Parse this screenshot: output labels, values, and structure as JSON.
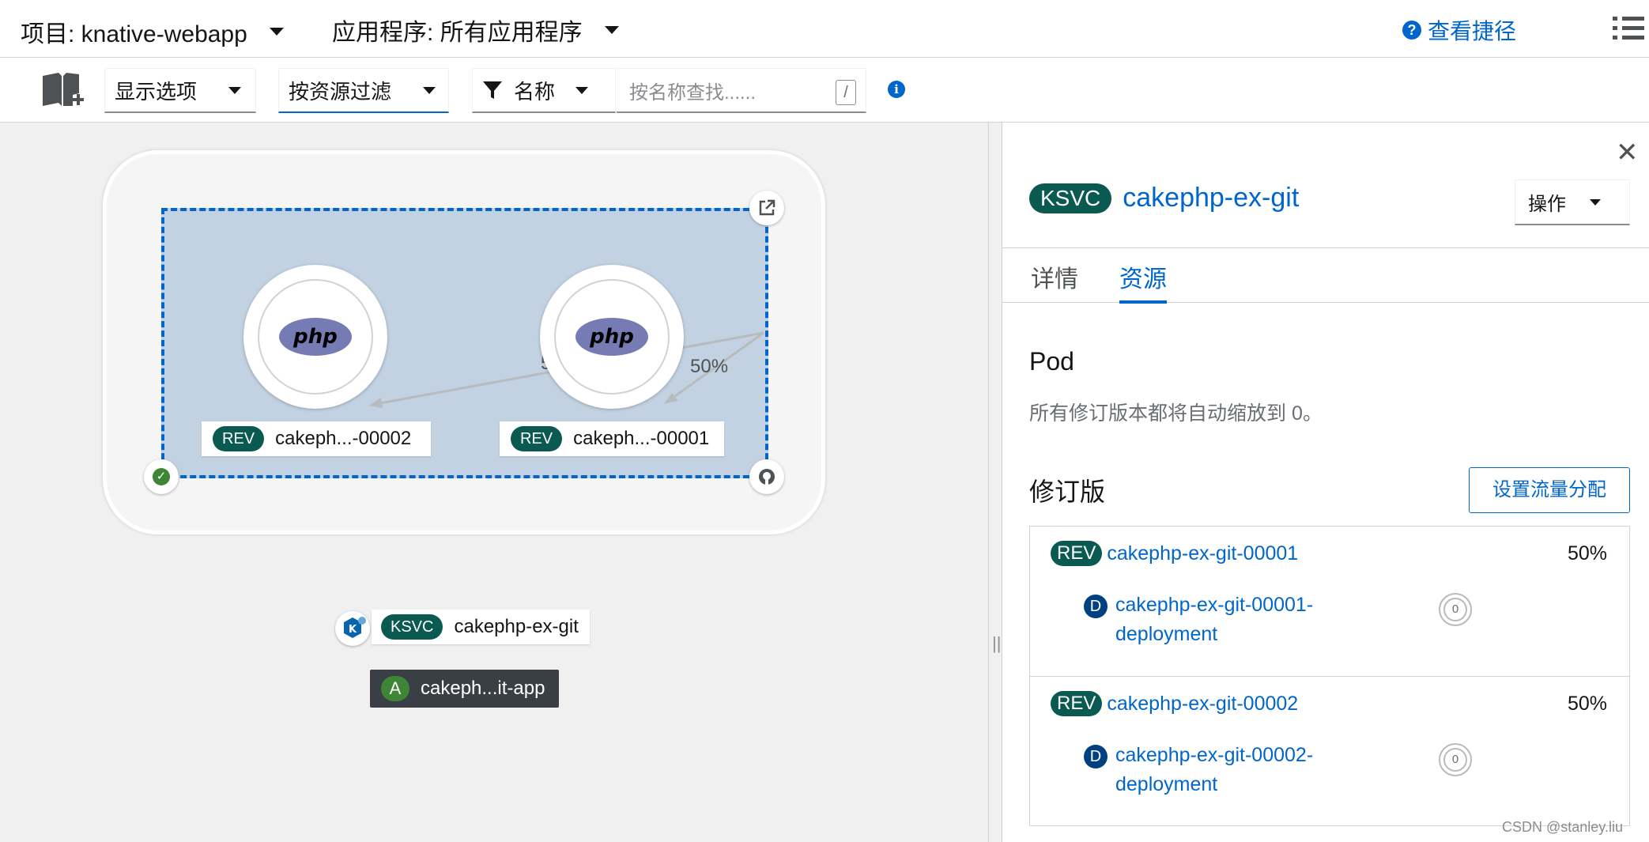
{
  "topbar": {
    "project": "项目: knative-webapp",
    "application": "应用程序: 所有应用程序",
    "shortcuts": "查看捷径"
  },
  "toolbar": {
    "display_options": "显示选项",
    "filter_by_resource": "按资源过滤",
    "filter_type": "名称",
    "search_placeholder": "按名称查找......",
    "search_hotkey": "/"
  },
  "topology": {
    "traffic_left": "50%",
    "traffic_right": "50%",
    "revisions": [
      {
        "badge": "REV",
        "label": "cakeph...-00002"
      },
      {
        "badge": "REV",
        "label": "cakeph...-00001"
      }
    ],
    "node_logo": "php",
    "service": {
      "badge": "KSVC",
      "label": "cakephp-ex-git"
    },
    "application": {
      "badge": "A",
      "label": "cakeph...it-app"
    },
    "status_color": "#3e8635",
    "accent_color": "#0066cc"
  },
  "panel": {
    "badge": "KSVC",
    "title": "cakephp-ex-git",
    "actions": "操作",
    "tabs": [
      "详情",
      "资源"
    ],
    "active_tab": "资源",
    "pod_heading": "Pod",
    "pod_message": "所有修订版本都将自动缩放到 0。",
    "revisions_heading": "修订版",
    "traffic_button": "设置流量分配",
    "revisions": [
      {
        "badge": "REV",
        "name": "cakephp-ex-git-00001",
        "percent": "50%",
        "deployment_badge": "D",
        "deployment_line1": "cakephp-ex-git-00001-",
        "deployment_line2": "deployment",
        "pods": "0"
      },
      {
        "badge": "REV",
        "name": "cakephp-ex-git-00002",
        "percent": "50%",
        "deployment_badge": "D",
        "deployment_line1": "cakephp-ex-git-00002-",
        "deployment_line2": "deployment",
        "pods": "0"
      }
    ]
  },
  "watermark": "CSDN @stanley.liu",
  "icons": [
    "chevron-down-icon",
    "help-icon",
    "list-view-icon",
    "topology-book-icon",
    "filter-icon",
    "info-icon",
    "external-link-icon",
    "check-icon",
    "github-icon",
    "knative-icon",
    "close-icon",
    "pod-ring-icon"
  ]
}
